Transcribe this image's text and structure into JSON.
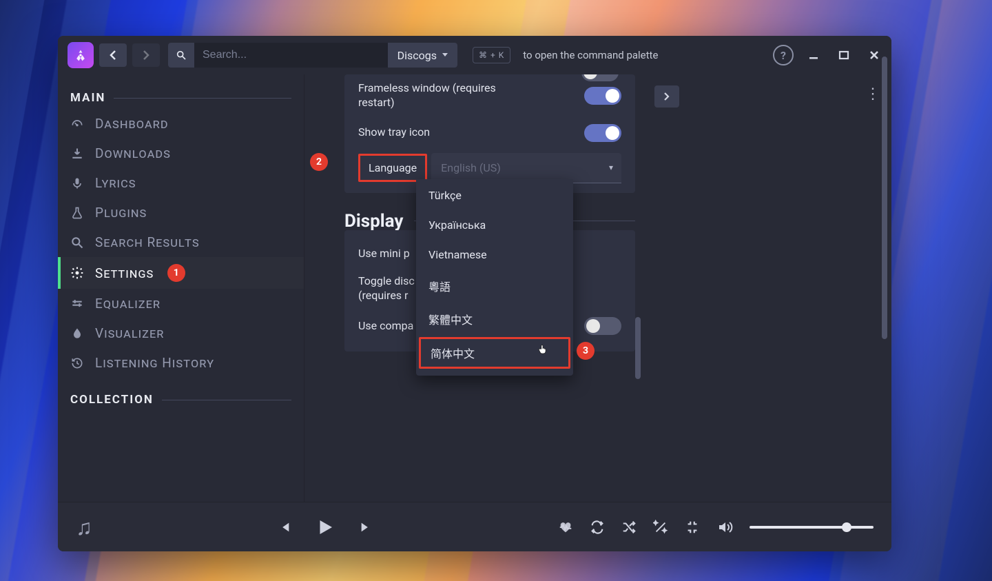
{
  "search": {
    "placeholder": "Search...",
    "provider": "Discogs"
  },
  "cmdHint": {
    "kbd": "⌘ + K",
    "text": "to open the command palette"
  },
  "sidebar": {
    "section1": "MAIN",
    "section2": "COLLECTION",
    "items": [
      {
        "label": "Dashboard"
      },
      {
        "label": "Downloads"
      },
      {
        "label": "Lyrics"
      },
      {
        "label": "Plugins"
      },
      {
        "label": "Search Results"
      },
      {
        "label": "Settings"
      },
      {
        "label": "Equalizer"
      },
      {
        "label": "Visualizer"
      },
      {
        "label": "Listening History"
      }
    ]
  },
  "settings": {
    "frameless": "Frameless window (requires restart)",
    "tray": "Show tray icon",
    "languageLabel": "Language",
    "languageValue": "English (US)",
    "displayHeader": "Display",
    "miniPlayer": "Use mini p",
    "discToggle": "Toggle disc\n(requires r",
    "compact": "Use compa"
  },
  "dropdown": {
    "items": [
      "Türkçe",
      "Українська",
      "Vietnamese",
      "粵語",
      "繁體中文",
      "简体中文"
    ]
  },
  "markers": {
    "m1": "1",
    "m2": "2",
    "m3": "3"
  }
}
